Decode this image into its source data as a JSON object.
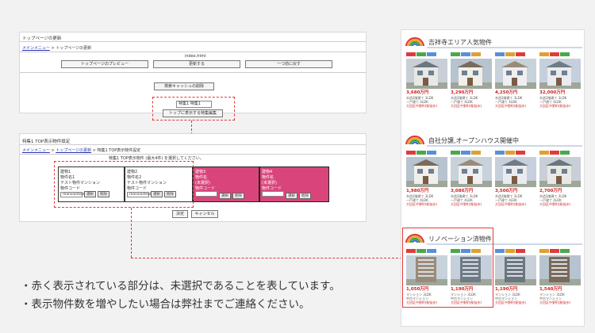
{
  "admin": {
    "title": "トップページの更新",
    "breadcrumb": {
      "link": "メインメニュー",
      "sep": " > ",
      "current": "トップページの更新"
    },
    "filename": "index.html",
    "buttons": {
      "preview": "トップページのプレビュー",
      "update": "更新する",
      "back": "一つ前に戻す",
      "clear_cache": "検索キャッシュの削除",
      "edit_feature": "トップに表示する特集編集"
    },
    "feature_select": "特集1 特集1",
    "feature_settings": {
      "title": "特集1 TOP表示物件設定",
      "breadcrumb": {
        "link1": "メインメニュー",
        "link2": "トップページの更新",
        "current": "特集1 TOP表示物件設定"
      },
      "note": "特集1 TOP表示物件 (最大4件) を選択してください。",
      "slots": [
        {
          "label": "建物1",
          "line1": "物件名1",
          "line2": "テスト物件マンション",
          "code_label": "物件コード",
          "code": "mansiontest1",
          "select": "選択",
          "delete": "削除",
          "state": "selected"
        },
        {
          "label": "建物2",
          "line1": "物件名2",
          "line2": "テスト物件マンション",
          "code_label": "物件コード",
          "code": "mansiontest2",
          "select": "選択",
          "delete": "削除",
          "state": "selected"
        },
        {
          "label": "建物3",
          "line1": "物件名",
          "line2": "(未選択)",
          "code_label": "物件コード",
          "code": "",
          "select": "選択",
          "delete": "削除",
          "state": "unselected"
        },
        {
          "label": "建物4",
          "line1": "物件名",
          "line2": "(未選択)",
          "code_label": "物件コード",
          "code": "",
          "select": "選択",
          "delete": "削除",
          "state": "unselected"
        }
      ],
      "ok": "決定",
      "cancel": "キャンセル"
    }
  },
  "notes": [
    "・赤く表示されている部分は、未選択であることを表しています。",
    "・表示物件数を増やしたい場合は弊社までご連絡ください。"
  ],
  "preview": {
    "sections": [
      {
        "title": "吉祥寺エリア人気物件",
        "cards": [
          {
            "price": "3,680万円",
            "line1": "木造2階建て 3LDK",
            "line2": "一戸建て 4LDK",
            "line3": "大田区中野町(駅徒歩)"
          },
          {
            "price": "3,290万円",
            "line1": "木造2階建て 3LDK",
            "line2": "一戸建て 4LDK",
            "line3": "大田区中野町(駅徒歩)"
          },
          {
            "price": "4,250万円",
            "line1": "木造2階建て 3LDK",
            "line2": "一戸建て 4LDK",
            "line3": "大田区中野町(駅徒歩)"
          },
          {
            "price": "32,000万円",
            "line1": "木造2階建て 3LDK",
            "line2": "一戸建て 4LDK",
            "line3": "大田区中野町(駅徒歩)"
          }
        ]
      },
      {
        "title": "自社分譲,オープンハウス開催中",
        "cards": [
          {
            "price": "1,980万円",
            "line1": "木造2階建て 3LDK",
            "line2": "一戸建て 4LDK",
            "line3": "大田区中野町(駅徒歩)"
          },
          {
            "price": "3,080万円",
            "line1": "木造2階建て 3LDK",
            "line2": "一戸建て 4LDK",
            "line3": "大田区中野町(駅徒歩)"
          },
          {
            "price": "3,500万円",
            "line1": "木造2階建て 3LDK",
            "line2": "一戸建て 4LDK",
            "line3": "大田区中野町(駅徒歩)"
          },
          {
            "price": "2,700万円",
            "line1": "木造2階建て 3LDK",
            "line2": "一戸建て 4LDK",
            "line3": "大田区中野町(駅徒歩)"
          }
        ]
      },
      {
        "title": "リノベーション済物件",
        "cards": [
          {
            "price": "1,050万円",
            "line1": "マンション 3LDK",
            "line2": "中古マンション",
            "line3": "大田区中野町(駅徒歩)"
          },
          {
            "price": "1,190万円",
            "line1": "マンション 3LDK",
            "line2": "中古マンション",
            "line3": "大田区中野町(駅徒歩)"
          },
          {
            "price": "1,190万円",
            "line1": "マンション 3LDK",
            "line2": "中古マンション",
            "line3": "大田区中野町(駅徒歩)"
          },
          {
            "price": "1,540万円",
            "line1": "マンション 3LDK",
            "line2": "中古マンション",
            "line3": "大田区中野町(駅徒歩)"
          }
        ]
      }
    ]
  },
  "colors": {
    "accent_red": "#e23a3a",
    "unselected_pink": "#d9457a",
    "price_red": "#d02020"
  }
}
